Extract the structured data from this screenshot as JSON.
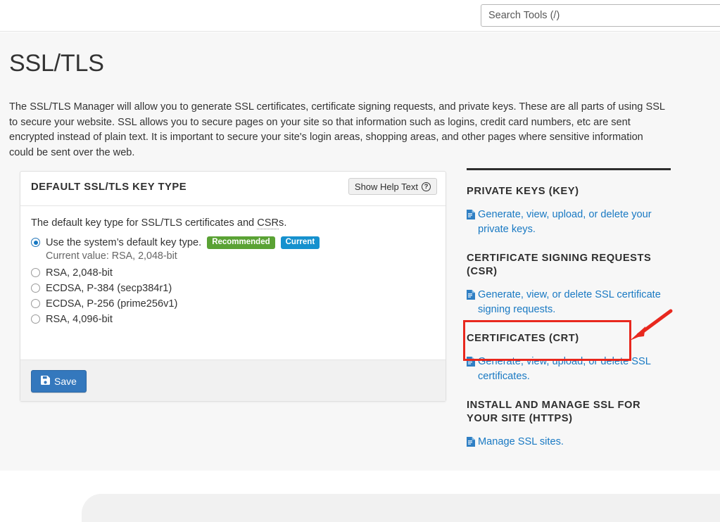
{
  "topbar": {
    "search_placeholder": "Search Tools (/)",
    "search_value": ""
  },
  "page": {
    "title": "SSL/TLS",
    "intro": "The SSL/TLS Manager will allow you to generate SSL certificates, certificate signing requests, and private keys. These are all parts of using SSL to secure your website. SSL allows you to secure pages on your site so that information such as logins, credit card numbers, etc are sent encrypted instead of plain text. It is important to secure your site's login areas, shopping areas, and other pages where sensitive information could be sent over the web."
  },
  "card": {
    "title": "DEFAULT SSL/TLS KEY TYPE",
    "help_button_label": "Show Help Text",
    "help_icon": "question-circle-icon",
    "description_prefix": "The default key type for SSL/TLS certificates and ",
    "description_abbr": "CSR",
    "description_suffix": "s.",
    "options": [
      {
        "label": "Use the system’s default key type.",
        "checked": true,
        "badges": [
          {
            "text": "Recommended",
            "color": "#5aa234"
          },
          {
            "text": "Current",
            "color": "#1691ce"
          }
        ],
        "sub_label": "Current value: RSA, 2,048-bit"
      },
      {
        "label": "RSA, 2,048-bit",
        "checked": false,
        "badges": [],
        "sub_label": ""
      },
      {
        "label": "ECDSA, P-384 (secp384r1)",
        "checked": false,
        "badges": [],
        "sub_label": ""
      },
      {
        "label": "ECDSA, P-256 (prime256v1)",
        "checked": false,
        "badges": [],
        "sub_label": ""
      },
      {
        "label": "RSA, 4,096-bit",
        "checked": false,
        "badges": [],
        "sub_label": ""
      }
    ],
    "save_label": "Save",
    "save_icon": "floppy-disk-icon"
  },
  "sidebar": {
    "sections": [
      {
        "title": "PRIVATE KEYS (KEY)",
        "link": "Generate, view, upload, or delete your private keys.",
        "icon": "file-document-icon",
        "highlighted": false
      },
      {
        "title": "CERTIFICATE SIGNING REQUESTS (CSR)",
        "link": "Generate, view, or delete SSL certificate signing requests.",
        "icon": "file-document-icon",
        "highlighted": true
      },
      {
        "title": "CERTIFICATES (CRT)",
        "link": "Generate, view, upload, or delete SSL certificates.",
        "icon": "file-document-icon",
        "highlighted": false
      },
      {
        "title": "INSTALL AND MANAGE SSL FOR YOUR SITE (HTTPS)",
        "link": "Manage SSL sites.",
        "icon": "file-document-icon",
        "highlighted": false
      }
    ]
  },
  "annotation": {
    "box_color": "#e8281e",
    "arrow_color": "#e8281e",
    "target": "Generate, view, or delete SSL certificate signing requests."
  },
  "colors": {
    "link": "#1979c3",
    "primary_button": "#3478bd",
    "page_background": "#f7f7f7"
  }
}
